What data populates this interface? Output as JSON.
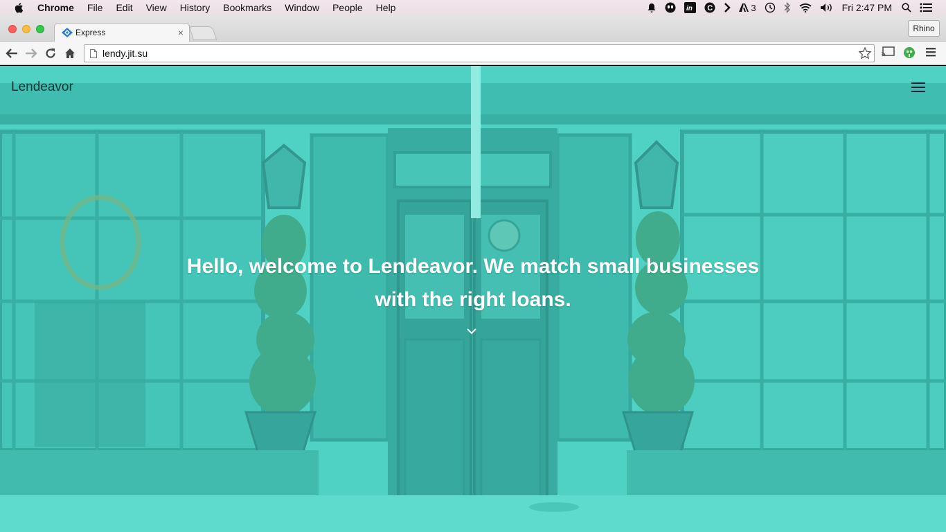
{
  "menubar": {
    "app": "Chrome",
    "items": [
      "File",
      "Edit",
      "View",
      "History",
      "Bookmarks",
      "Window",
      "People",
      "Help"
    ],
    "status": {
      "adobe_count": "3",
      "clock": "Fri 2:47 PM"
    }
  },
  "browser": {
    "tab_title": "Express",
    "tab_close": "×",
    "profile": "Rhino",
    "url": "lendy.jit.su"
  },
  "page": {
    "brand": "Lendeavor",
    "hero_line1": "Hello, welcome to Lendeavor. We match small businesses",
    "hero_line2": "with the right loans."
  },
  "colors": {
    "overlay": "#4ae2d2",
    "scene_dark": "#2f9d94",
    "scene_mid": "#41b8ad"
  }
}
